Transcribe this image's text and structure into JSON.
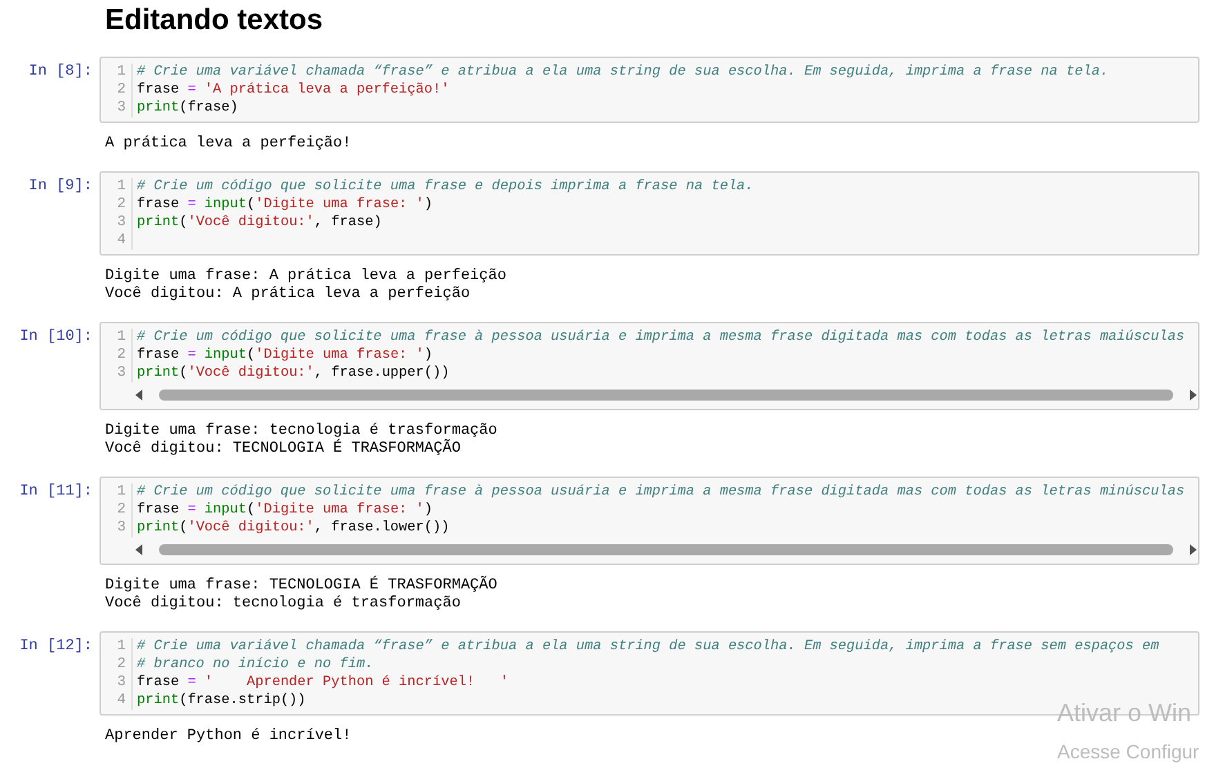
{
  "title": "Editando textos",
  "cells": [
    {
      "prompt": "In [8]:",
      "lines": [
        {
          "number": "1",
          "tokens": [
            {
              "kind": "comment",
              "text": "# Crie uma variável chamada “frase” e atribua a ela uma string de sua escolha. Em seguida, imprima a frase na tela."
            }
          ]
        },
        {
          "number": "2",
          "tokens": [
            {
              "kind": "name",
              "text": "frase "
            },
            {
              "kind": "operator",
              "text": "= "
            },
            {
              "kind": "string",
              "text": "'A prática leva a perfeição!'"
            }
          ]
        },
        {
          "number": "3",
          "tokens": [
            {
              "kind": "builtin",
              "text": "print"
            },
            {
              "kind": "name",
              "text": "(frase)"
            }
          ]
        }
      ],
      "horizontal_scrollbar": false,
      "output": [
        "A prática leva a perfeição!"
      ]
    },
    {
      "prompt": "In [9]:",
      "lines": [
        {
          "number": "1",
          "tokens": [
            {
              "kind": "comment",
              "text": "# Crie um código que solicite uma frase e depois imprima a frase na tela."
            }
          ]
        },
        {
          "number": "2",
          "tokens": [
            {
              "kind": "name",
              "text": "frase "
            },
            {
              "kind": "operator",
              "text": "= "
            },
            {
              "kind": "builtin",
              "text": "input"
            },
            {
              "kind": "name",
              "text": "("
            },
            {
              "kind": "string",
              "text": "'Digite uma frase: '"
            },
            {
              "kind": "name",
              "text": ")"
            }
          ]
        },
        {
          "number": "3",
          "tokens": [
            {
              "kind": "builtin",
              "text": "print"
            },
            {
              "kind": "name",
              "text": "("
            },
            {
              "kind": "string",
              "text": "'Você digitou:'"
            },
            {
              "kind": "name",
              "text": ", frase)"
            }
          ]
        },
        {
          "number": "4"
        }
      ],
      "horizontal_scrollbar": false,
      "output": [
        "Digite uma frase: A prática leva a perfeição",
        "Você digitou: A prática leva a perfeição"
      ]
    },
    {
      "prompt": "In [10]:",
      "lines": [
        {
          "number": "1",
          "tokens": [
            {
              "kind": "comment",
              "text": "# Crie um código que solicite uma frase à pessoa usuária e imprima a mesma frase digitada mas com todas as letras maiúsculas"
            }
          ]
        },
        {
          "number": "2",
          "tokens": [
            {
              "kind": "name",
              "text": "frase "
            },
            {
              "kind": "operator",
              "text": "= "
            },
            {
              "kind": "builtin",
              "text": "input"
            },
            {
              "kind": "name",
              "text": "("
            },
            {
              "kind": "string",
              "text": "'Digite uma frase: '"
            },
            {
              "kind": "name",
              "text": ")"
            }
          ]
        },
        {
          "number": "3",
          "tokens": [
            {
              "kind": "builtin",
              "text": "print"
            },
            {
              "kind": "name",
              "text": "("
            },
            {
              "kind": "string",
              "text": "'Você digitou:'"
            },
            {
              "kind": "name",
              "text": ", frase.upper())"
            }
          ]
        }
      ],
      "horizontal_scrollbar": true,
      "output": [
        "Digite uma frase: tecnologia é trasformação",
        "Você digitou: TECNOLOGIA É TRASFORMAÇÃO"
      ]
    },
    {
      "prompt": "In [11]:",
      "lines": [
        {
          "number": "1",
          "tokens": [
            {
              "kind": "comment",
              "text": "# Crie um código que solicite uma frase à pessoa usuária e imprima a mesma frase digitada mas com todas as letras minúsculas"
            }
          ]
        },
        {
          "number": "2",
          "tokens": [
            {
              "kind": "name",
              "text": "frase "
            },
            {
              "kind": "operator",
              "text": "= "
            },
            {
              "kind": "builtin",
              "text": "input"
            },
            {
              "kind": "name",
              "text": "("
            },
            {
              "kind": "string",
              "text": "'Digite uma frase: '"
            },
            {
              "kind": "name",
              "text": ")"
            }
          ]
        },
        {
          "number": "3",
          "tokens": [
            {
              "kind": "builtin",
              "text": "print"
            },
            {
              "kind": "name",
              "text": "("
            },
            {
              "kind": "string",
              "text": "'Você digitou:'"
            },
            {
              "kind": "name",
              "text": ", frase.lower())"
            }
          ]
        }
      ],
      "horizontal_scrollbar": true,
      "output": [
        "Digite uma frase: TECNOLOGIA É TRASFORMAÇÃO",
        "Você digitou: tecnologia é trasformação"
      ]
    },
    {
      "prompt": "In [12]:",
      "lines": [
        {
          "number": "1",
          "tokens": [
            {
              "kind": "comment",
              "text": "# Crie uma variável chamada “frase” e atribua a ela uma string de sua escolha. Em seguida, imprima a frase sem espaços em"
            }
          ]
        },
        {
          "number": "2",
          "tokens": [
            {
              "kind": "comment",
              "text": "# branco no início e no fim."
            }
          ]
        },
        {
          "number": "3",
          "tokens": [
            {
              "kind": "name",
              "text": "frase "
            },
            {
              "kind": "operator",
              "text": "= "
            },
            {
              "kind": "string",
              "text": "'    Aprender Python é incrível!   '"
            }
          ]
        },
        {
          "number": "4",
          "tokens": [
            {
              "kind": "builtin",
              "text": "print"
            },
            {
              "kind": "name",
              "text": "(frase.strip())"
            }
          ]
        }
      ],
      "horizontal_scrollbar": false,
      "output": [
        "Aprender Python é incrível!"
      ]
    }
  ],
  "activation_notice": {
    "title": "Ativar o Win",
    "subtitle": "Acesse Configur"
  }
}
